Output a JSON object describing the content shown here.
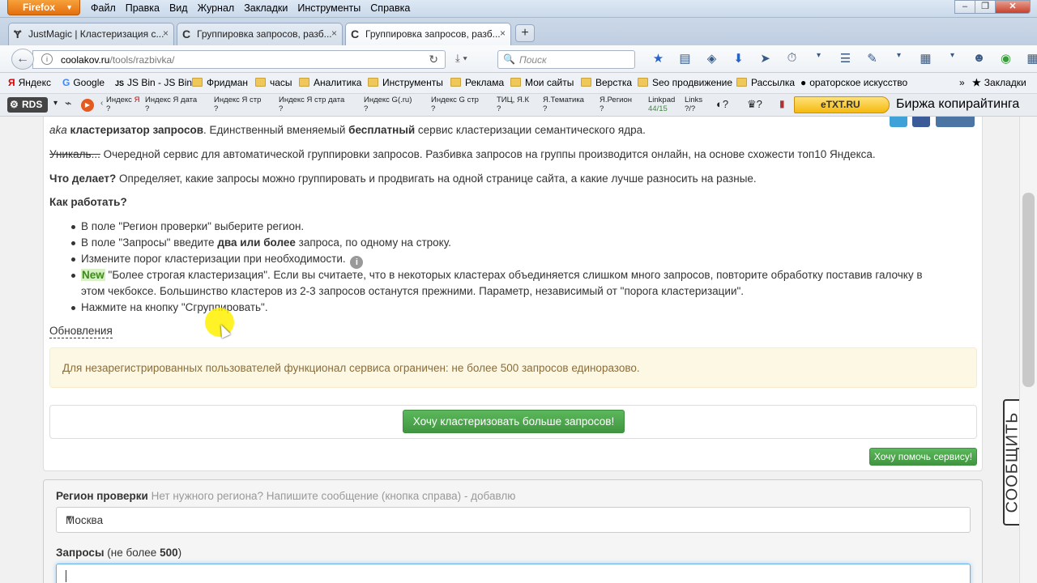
{
  "browser": {
    "firefox_label": "Firefox",
    "menu": [
      "Файл",
      "Правка",
      "Вид",
      "Журнал",
      "Закладки",
      "Инструменты",
      "Справка"
    ],
    "window_controls": [
      "–",
      "❐",
      "✕"
    ]
  },
  "tabs": [
    {
      "icon": "Ɏ",
      "label": "JustMagic | Кластеризация с...",
      "close": "×"
    },
    {
      "icon": "C",
      "label": "Группировка запросов, разб...",
      "close": "×"
    },
    {
      "icon": "C",
      "label": "Группировка запросов, разб...",
      "close": "×"
    }
  ],
  "new_tab_label": "+",
  "navbar": {
    "url_host": "coolakov.ru",
    "url_path": "/tools/razbivka/",
    "search_placeholder": "Поиск"
  },
  "bookmarks": [
    {
      "label": "Яндекс",
      "icon": "Я"
    },
    {
      "label": "Google",
      "icon": "G"
    },
    {
      "label": "JS Bin - JS Bin",
      "icon": "JS"
    },
    {
      "label": "Фридман"
    },
    {
      "label": "часы"
    },
    {
      "label": "Аналитика"
    },
    {
      "label": "Инструменты"
    },
    {
      "label": "Реклама"
    },
    {
      "label": "Мои сайты"
    },
    {
      "label": "Верстка"
    },
    {
      "label": "Seo продвижение"
    },
    {
      "label": "Рассылка"
    },
    {
      "label": "ораторское искусство"
    }
  ],
  "bookmarks_overflow": "»",
  "bookmarks_menu": "Закладки",
  "addon_bar": {
    "rds": "RDS",
    "seo_items": [
      {
        "top": "Индекс",
        "mid": "Я"
      },
      {
        "top": "Индекс Я дата",
        "mid": "?"
      },
      {
        "top": "Индекс Я стр",
        "mid": "?"
      },
      {
        "top": "Индекс Я стр дата",
        "mid": "?"
      },
      {
        "top": "Индекс G(.ru)",
        "mid": "?"
      },
      {
        "top": "Индекс G стр",
        "mid": "?"
      },
      {
        "top": "ТИЦ, Я.К",
        "mid": "?"
      },
      {
        "top": "Я.Тематика",
        "mid": "?"
      },
      {
        "top": "Я.Регион",
        "mid": "?"
      },
      {
        "top": "Linkpad",
        "mid": "44/15"
      },
      {
        "top": "Links",
        "mid": "?/?"
      }
    ],
    "etxt": "eTXT.RU",
    "birzha": "Биржа копирайтинга"
  },
  "content": {
    "intro_aka": "aka",
    "intro_bold1": "кластеризатор запросов",
    "intro_mid": ". Единственный вменяемый",
    "intro_bold2": "бесплатный",
    "intro_end": "сервис кластеризации семантического ядра.",
    "unique_strike": "Уникаль...",
    "unique_text": "Очередной сервис для автоматической группировки запросов. Разбивка запросов на группы производится онлайн, на основе схожести топ10 Яндекса.",
    "what_q": "Что делает?",
    "what_a": "Определяет, какие запросы можно группировать и продвигать на одной странице сайта, а какие лучше разносить на разные.",
    "how_title": "Как работать?",
    "steps": [
      "В поле \"Регион проверки\" выберите регион.",
      "В поле \"Запросы\" введите",
      "Измените порог кластеризации при необходимости.",
      "\"Более строгая кластеризация\". Если вы считаете, что в некоторых кластерах объединяется слишком много запросов, повторите обработку поставив галочку в",
      "этом чекбоксе. Большинство кластеров из 2-3 запросов останутся прежними. Параметр, независимый от \"порога кластеризации\".",
      "Нажмите на кнопку \"Сгруппировать\"."
    ],
    "step2_bold": "два или более",
    "step2_end": "запроса, по одному на строку.",
    "new_tag": "New",
    "info_icon": "i",
    "updates_link": "Обновления",
    "alert": "Для незарегистрированных пользователей функционал сервиса ограничен: не более 500 запросов единоразово.",
    "more_button": "Хочу кластеризовать больше запросов!",
    "help_button": "Хочу помочь сервису!"
  },
  "form": {
    "region_label": "Регион проверки",
    "region_hint": "Нет нужного региона? Напишите сообщение (кнопка справа) - добавлю",
    "region_value": "Москва",
    "queries_label": "Запросы",
    "queries_hint_pre": "(не более",
    "queries_hint_num": "500",
    "queries_hint_post": ")"
  },
  "side_widget": "СООБЩИТЬ",
  "colors": {
    "accent_green": "#5cb85c",
    "alert_bg": "#fcf8e3",
    "alert_text": "#8a6d3b",
    "firefox_orange": "#e46f0f"
  }
}
